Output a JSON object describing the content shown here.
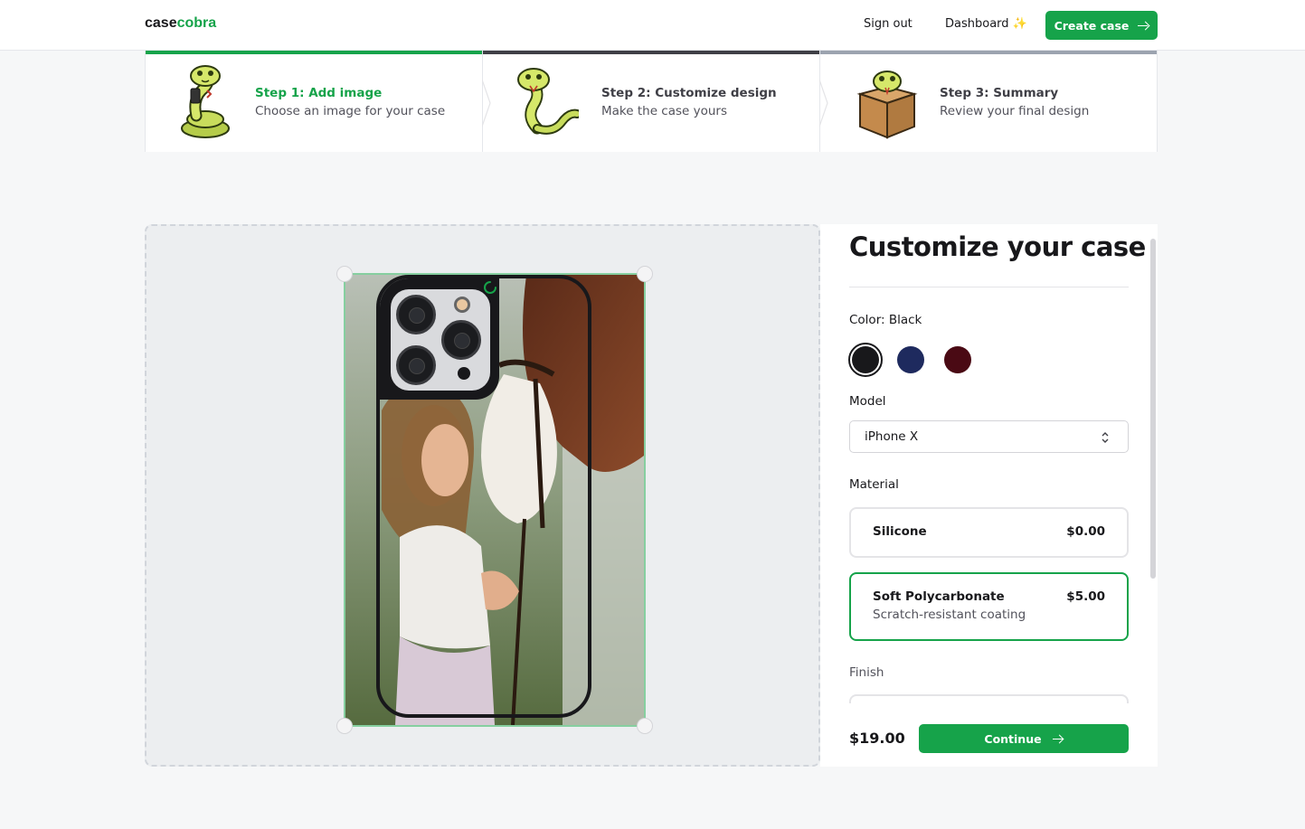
{
  "navbar": {
    "logo_prefix": "case",
    "logo_suffix": "cobra",
    "signout_label": "Sign out",
    "dashboard_label": "Dashboard",
    "dashboard_icon": "sparkle-icon",
    "create_label": "Create case"
  },
  "steps": [
    {
      "title": "Step 1: Add image",
      "subtitle": "Choose an image for your case",
      "status": "complete"
    },
    {
      "title": "Step 2: Customize design",
      "subtitle": "Make the case yours",
      "status": "current"
    },
    {
      "title": "Step 3: Summary",
      "subtitle": "Review your final design",
      "status": "upcoming"
    }
  ],
  "panel": {
    "title": "Customize your case",
    "color_label": "Color: Black",
    "colors": [
      {
        "name": "Black",
        "hex": "#18181b",
        "selected": true
      },
      {
        "name": "Blue",
        "hex": "#1e2a5e",
        "selected": false
      },
      {
        "name": "Rose",
        "hex": "#4a0a14",
        "selected": false
      }
    ],
    "model_label": "Model",
    "model_value": "iPhone X",
    "material_label": "Material",
    "materials": [
      {
        "name": "Silicone",
        "description": "",
        "price": "$0.00",
        "selected": false
      },
      {
        "name": "Soft Polycarbonate",
        "description": "Scratch-resistant coating",
        "price": "$5.00",
        "selected": true
      }
    ],
    "finish_label": "Finish",
    "total": "$19.00",
    "continue_label": "Continue"
  },
  "colors": {
    "accent": "#16a34a",
    "frame_border": "#86cfa0"
  }
}
